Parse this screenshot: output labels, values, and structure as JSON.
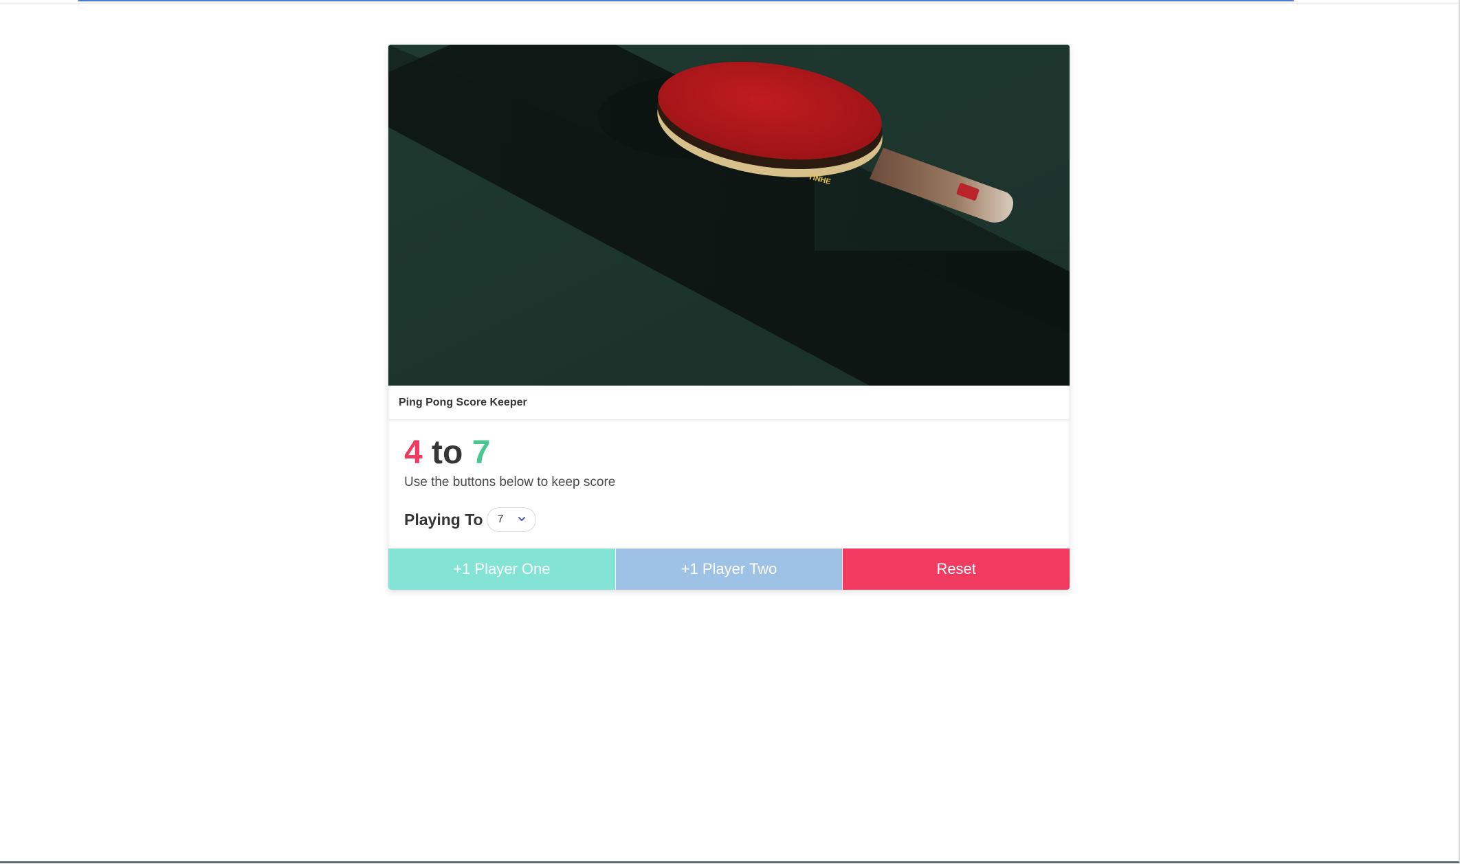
{
  "card": {
    "header_title": "Ping Pong Score Keeper",
    "image_alt": "Red ping pong paddle on a dark green table",
    "image_brand_text": "YINHE"
  },
  "score": {
    "player_one": "4",
    "separator": "to",
    "player_two": "7",
    "player_one_color": "#f03a5f",
    "player_two_color": "#48c78e"
  },
  "subtitle": "Use the buttons below to keep score",
  "playing_to": {
    "label": "Playing To",
    "selected_value": "7"
  },
  "buttons": {
    "player_one": "+1 Player One",
    "player_two": "+1 Player Two",
    "reset": "Reset",
    "player_one_color": "#83e3d4",
    "player_two_color": "#9ec1e6",
    "reset_color": "#f03a5f"
  }
}
